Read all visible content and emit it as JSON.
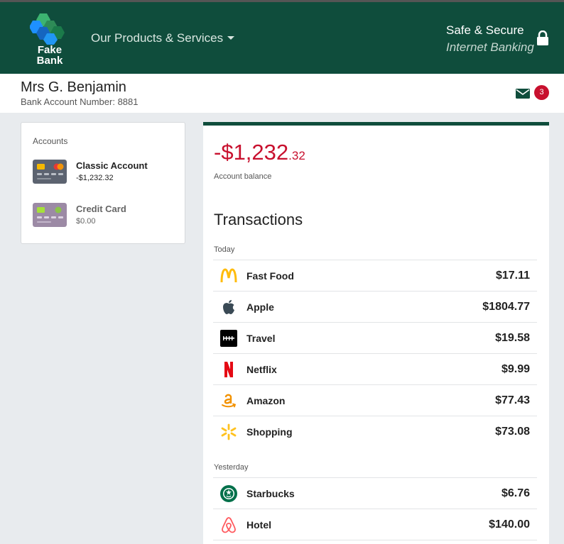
{
  "header": {
    "logo_line1": "Fake",
    "logo_line2": "Bank",
    "products_label": "Our Products & Services",
    "secure_line1": "Safe & Secure",
    "secure_line2": "Internet Banking"
  },
  "user": {
    "name": "Mrs G. Benjamin",
    "account_number": "Bank Account Number: 8881",
    "message_count": "3"
  },
  "accounts": {
    "title": "Accounts",
    "items": [
      {
        "name": "Classic Account",
        "balance": "-$1,232.32"
      },
      {
        "name": "Credit Card",
        "balance": "$0.00"
      }
    ]
  },
  "balance": {
    "main": "-$1,232",
    "cents": ".32",
    "label": "Account balance"
  },
  "transactions": {
    "title": "Transactions",
    "today_label": "Today",
    "yesterday_label": "Yesterday",
    "today": [
      {
        "name": "Fast Food",
        "amount": "$17.11",
        "icon": "mcdonalds-icon"
      },
      {
        "name": "Apple",
        "amount": "$1804.77",
        "icon": "apple-icon"
      },
      {
        "name": "Travel",
        "amount": "$19.58",
        "icon": "uber-icon"
      },
      {
        "name": "Netflix",
        "amount": "$9.99",
        "icon": "netflix-icon"
      },
      {
        "name": "Amazon",
        "amount": "$77.43",
        "icon": "amazon-icon"
      },
      {
        "name": "Shopping",
        "amount": "$73.08",
        "icon": "walmart-icon"
      }
    ],
    "yesterday": [
      {
        "name": "Starbucks",
        "amount": "$6.76",
        "icon": "starbucks-icon"
      },
      {
        "name": "Hotel",
        "amount": "$140.00",
        "icon": "airbnb-icon"
      }
    ]
  },
  "colors": {
    "brand_green": "#0f4d3c",
    "negative_red": "#c8102e"
  }
}
